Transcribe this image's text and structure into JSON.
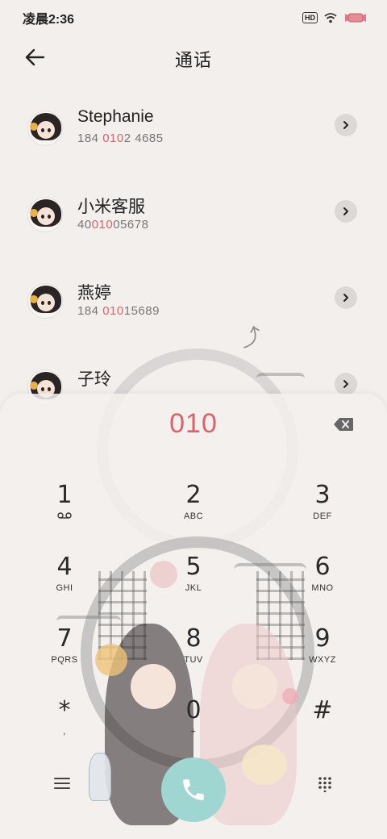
{
  "status_bar": {
    "time": "凌晨2:36",
    "hd_label": "HD",
    "icons": [
      "hd-voice-icon",
      "wifi-icon",
      "battery-icon"
    ]
  },
  "header": {
    "title": "通话",
    "back_icon": "arrow-left-icon"
  },
  "contacts": [
    {
      "name": "Stephanie",
      "number_pre": "184 ",
      "number_match": "010",
      "number_post": "2 4685"
    },
    {
      "name": "小米客服",
      "number_pre": "40",
      "number_match": "010",
      "number_post": "05678"
    },
    {
      "name": "燕婷",
      "number_pre": "184 ",
      "number_match": "010",
      "number_post": "15689"
    },
    {
      "name": "子玲",
      "number_pre": "",
      "number_match": "",
      "number_post": ""
    }
  ],
  "dialpad": {
    "input": "010",
    "keys": [
      {
        "digit": "1",
        "letters": ""
      },
      {
        "digit": "2",
        "letters": "ABC"
      },
      {
        "digit": "3",
        "letters": "DEF"
      },
      {
        "digit": "4",
        "letters": "GHI"
      },
      {
        "digit": "5",
        "letters": "JKL"
      },
      {
        "digit": "6",
        "letters": "MNO"
      },
      {
        "digit": "7",
        "letters": "PQRS"
      },
      {
        "digit": "8",
        "letters": "TUV"
      },
      {
        "digit": "9",
        "letters": "WXYZ"
      },
      {
        "digit": "*",
        "letters": ","
      },
      {
        "digit": "0",
        "letters": "+"
      },
      {
        "digit": "#",
        "letters": ""
      }
    ]
  },
  "colors": {
    "accent": "#d9636b",
    "call_button": "#9fd6d2",
    "background": "#f2efed"
  }
}
